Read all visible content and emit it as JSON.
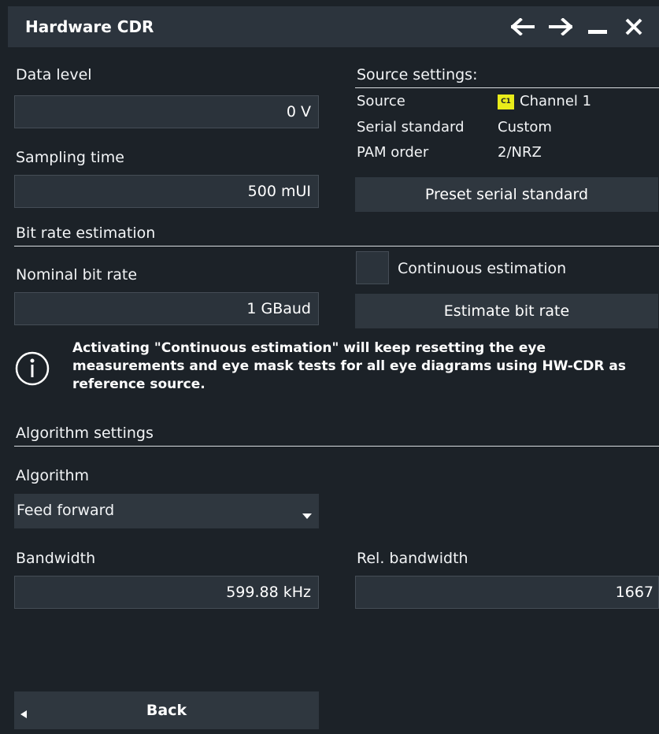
{
  "window": {
    "title": "Hardware CDR",
    "icons": [
      "arrow-left-icon",
      "arrow-right-icon",
      "minimize-icon",
      "close-icon"
    ]
  },
  "data_level": {
    "label": "Data level",
    "value": "0 V"
  },
  "sampling_time": {
    "label": "Sampling time",
    "value": "500 mUI"
  },
  "source_settings": {
    "heading": "Source settings:",
    "rows": [
      {
        "key": "Source",
        "value": "Channel 1",
        "badge": "C1"
      },
      {
        "key": "Serial standard",
        "value": "Custom"
      },
      {
        "key": "PAM order",
        "value": "2/NRZ"
      }
    ],
    "preset_button": "Preset serial standard"
  },
  "bit_rate_estimation": {
    "heading": "Bit rate estimation",
    "nominal_label": "Nominal bit rate",
    "nominal_value": "1 GBaud",
    "continuous_label": "Continuous estimation",
    "continuous_checked": false,
    "estimate_button": "Estimate bit rate"
  },
  "info_note": {
    "text": "Activating \"Continuous estimation\" will keep resetting the eye measurements and eye mask tests for all eye diagrams using HW-CDR as reference source."
  },
  "algorithm_settings": {
    "heading": "Algorithm settings",
    "algorithm_label": "Algorithm",
    "algorithm_value": "Feed forward",
    "bandwidth_label": "Bandwidth",
    "bandwidth_value": "599.88 kHz",
    "rel_bandwidth_label": "Rel. bandwidth",
    "rel_bandwidth_value": "1667"
  },
  "footer": {
    "back_label": "Back"
  },
  "colors": {
    "background": "#1c2228",
    "titlebar": "#2c343d",
    "field": "#2b333b",
    "button": "#2f373f",
    "channel_badge": "#e9ec1a"
  }
}
